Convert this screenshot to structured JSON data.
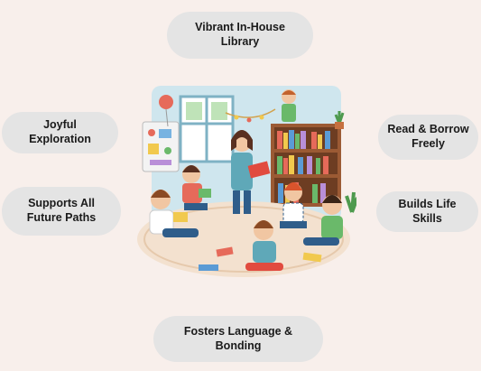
{
  "labels": {
    "top": "Vibrant In-House Library",
    "joyful": "Joyful Exploration",
    "supports": "Supports All Future Paths",
    "read_borrow": "Read & Borrow Freely",
    "life_skills": "Builds Life Skills",
    "bottom": "Fosters Language & Bonding"
  },
  "colors": {
    "background": "#f8efeb",
    "pill": "#e4e4e4"
  }
}
